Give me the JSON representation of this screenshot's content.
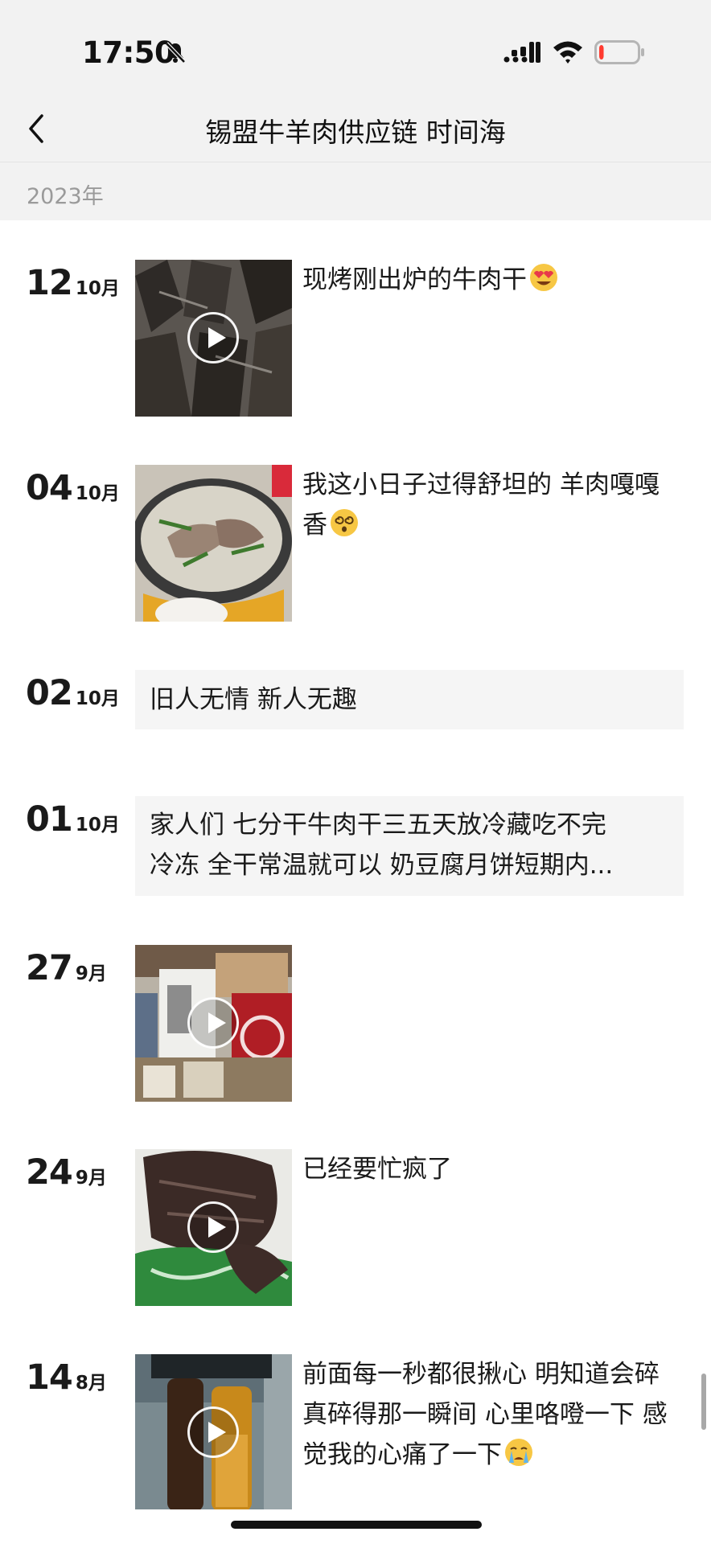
{
  "status_bar": {
    "time": "17:50",
    "battery_level": 0.12,
    "battery_color": "#ff3b30"
  },
  "nav": {
    "title": "锡盟牛羊肉供应链  时间海"
  },
  "year_label": "2023年",
  "posts": [
    {
      "day": "12",
      "month": "10月",
      "type": "video",
      "caption": "现烤刚出炉的牛肉干",
      "emoji": "heart-eyes-emoji"
    },
    {
      "day": "04",
      "month": "10月",
      "type": "image",
      "caption": "我这小日子过得舒坦的 羊肉嘎嘎香",
      "emoji": "dizzy-face-emoji"
    },
    {
      "day": "02",
      "month": "10月",
      "type": "text",
      "caption": "旧人无情  新人无趣"
    },
    {
      "day": "01",
      "month": "10月",
      "type": "text",
      "line1": "家人们 七分干牛肉干三五天放冷藏吃不完",
      "line2": "冷冻 全干常温就可以 奶豆腐月饼短期内..."
    },
    {
      "day": "27",
      "month": "9月",
      "type": "video",
      "caption": ""
    },
    {
      "day": "24",
      "month": "9月",
      "type": "video",
      "caption": "已经要忙疯了"
    },
    {
      "day": "14",
      "month": "8月",
      "type": "video",
      "caption": "前面每一秒都很揪心 明知道会碎 真碎得那一瞬间 心里咯噔一下 感觉我的心痛了一下",
      "emoji": "crying-face-emoji"
    }
  ]
}
